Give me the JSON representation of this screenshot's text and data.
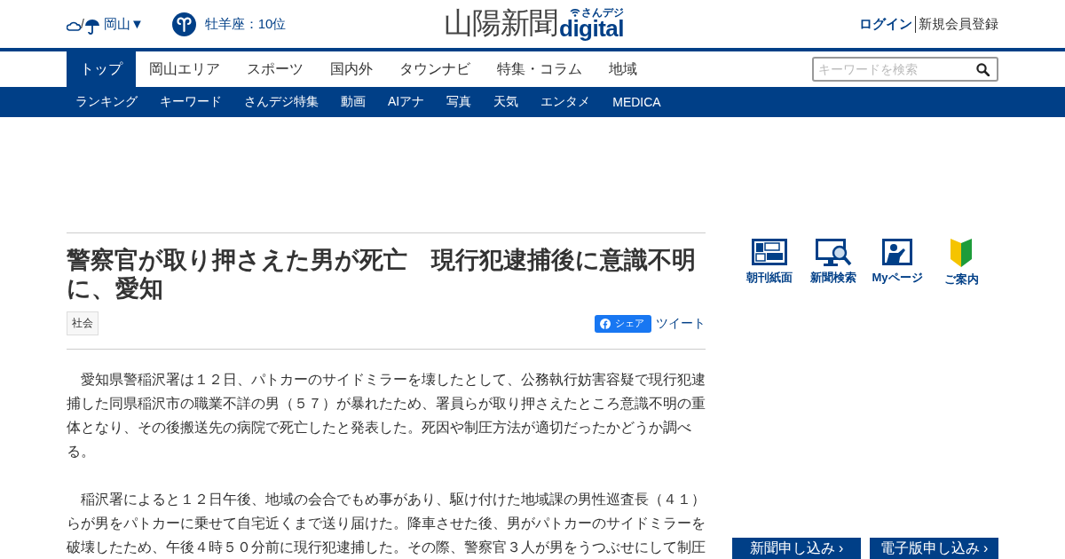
{
  "header": {
    "weather_separator": "/",
    "region": "岡山▼",
    "horoscope": "牡羊座：10位",
    "logo": {
      "main": "山陽新聞",
      "sub": "さんデジ",
      "brand": "digital"
    },
    "login": "ログイン",
    "register": "新規会員登録"
  },
  "nav": [
    {
      "label": "トップ",
      "selected": true
    },
    {
      "label": "岡山エリア",
      "selected": false
    },
    {
      "label": "スポーツ",
      "selected": false
    },
    {
      "label": "国内外",
      "selected": false
    },
    {
      "label": "タウンナビ",
      "selected": false
    },
    {
      "label": "特集・コラム",
      "selected": false
    },
    {
      "label": "地域",
      "selected": false
    }
  ],
  "search": {
    "placeholder": "キーワードを検索"
  },
  "subnav": [
    "ランキング",
    "キーワード",
    "さんデジ特集",
    "動画",
    "AIアナ",
    "写真",
    "天気",
    "エンタメ",
    "MEDICA"
  ],
  "article": {
    "title": "警察官が取り押さえた男が死亡　現行犯逮捕後に意識不明に、愛知",
    "category": "社会",
    "share": "シェア",
    "tweet": "ツイート",
    "paragraphs": [
      "愛知県警稲沢署は１２日、パトカーのサイドミラーを壊したとして、公務執行妨害容疑で現行犯逮捕した同県稲沢市の職業不詳の男（５７）が暴れたため、署員らが取り押さえたところ意識不明の重体となり、その後搬送先の病院で死亡したと発表した。死因や制圧方法が適切だったかどうか調べる。",
      "稲沢署によると１２日午後、地域の会合でもめ事があり、駆け付けた地域課の男性巡査長（４１）らが男をパトカーに乗せて自宅近くまで送り届けた。降車させた後、男がパトカーのサイドミラーを破壊したため、午後４時５０分前に現行犯逮捕した。その際、警察官３人が男をうつぶせにして制圧"
    ]
  },
  "sidebar": {
    "links": [
      {
        "kind": "paper",
        "label": "朝刊紙面"
      },
      {
        "kind": "search",
        "label": "新聞検索"
      },
      {
        "kind": "mypage",
        "label": "Myページ"
      },
      {
        "kind": "guide",
        "label": "ご案内"
      }
    ],
    "buttons": [
      "新聞申し込み ›",
      "電子版申し込み ›"
    ]
  }
}
